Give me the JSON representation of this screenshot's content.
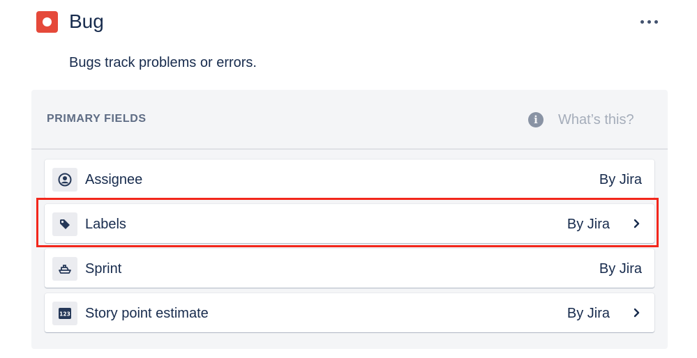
{
  "header": {
    "title": "Bug",
    "icon": "bug-issue-type-icon",
    "icon_color": "#e5493a",
    "more_icon": "more-horizontal-icon"
  },
  "description": "Bugs track problems or errors.",
  "panel": {
    "section_label": "PRIMARY FIELDS",
    "help_label": "What’s this?",
    "help_icon": "info-icon",
    "fields": [
      {
        "name": "Assignee",
        "source": "By Jira",
        "icon": "person-icon",
        "has_chevron": false
      },
      {
        "name": "Labels",
        "source": "By Jira",
        "icon": "tag-icon",
        "has_chevron": true,
        "highlighted": true
      },
      {
        "name": "Sprint",
        "source": "By Jira",
        "icon": "sprint-ship-icon",
        "has_chevron": false
      },
      {
        "name": "Story point estimate",
        "source": "By Jira",
        "icon": "number-123-icon",
        "has_chevron": true
      }
    ]
  },
  "colors": {
    "text": "#172b4d",
    "panel_bg": "#f4f5f7",
    "highlight": "#f2271c",
    "muted": "#a5adba"
  }
}
